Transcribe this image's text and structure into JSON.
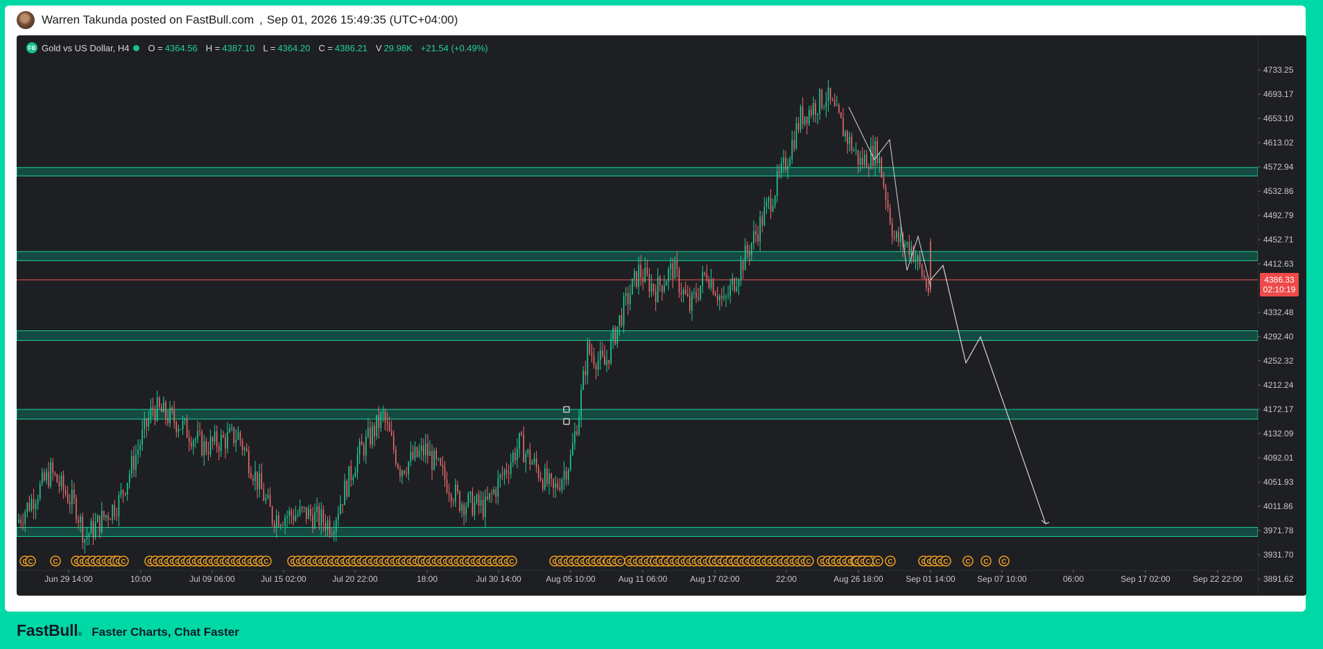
{
  "header": {
    "posted_by": "Warren Takunda posted on FastBull.com",
    "separator": ",",
    "timestamp": "Sep 01, 2026 15:49:35 (UTC+04:00)"
  },
  "legend": {
    "logo": "FB",
    "symbol": "Gold vs US Dollar, H4",
    "o_label": "O =",
    "o_value": "4364.56",
    "h_label": "H =",
    "h_value": "4387.10",
    "l_label": "L =",
    "l_value": "4364.20",
    "c_label": "C =",
    "c_value": "4386.21",
    "v_label": "V",
    "v_value": "29.98K",
    "change": "+21.54 (+0.49%)"
  },
  "price_tag": {
    "price": "4386.33",
    "countdown": "02:10:19"
  },
  "footer": {
    "logo": "FastBull",
    "reg": "®",
    "tagline": "Faster Charts, Chat Faster"
  },
  "colors": {
    "background": "#1e1f23",
    "up": "#1fd09a",
    "down": "#ee6b6b",
    "zone_fill": "#0c6e5b",
    "zone_border": "#1fd09a",
    "price_line": "#ee5555",
    "projection": "#d8d8d8",
    "event_markers": "#f0a020",
    "accent": "#00d9a6"
  },
  "chart_data": {
    "type": "candlestick",
    "symbol": "Gold vs US Dollar",
    "timeframe": "H4",
    "y_ticks": [
      4733.25,
      4693.17,
      4653.1,
      4613.02,
      4572.94,
      4532.86,
      4492.79,
      4452.71,
      4412.63,
      4386.33,
      4332.48,
      4292.4,
      4252.32,
      4212.24,
      4172.17,
      4132.09,
      4092.01,
      4051.93,
      4011.86,
      3971.78,
      3931.7,
      3891.62
    ],
    "x_ticks": [
      "Jun 29 14:00",
      "10:00",
      "Jul 09 06:00",
      "Jul 15 02:00",
      "Jul 20 22:00",
      "18:00",
      "Jul 30 14:00",
      "Aug 05 10:00",
      "Aug 11 06:00",
      "Aug 17 02:00",
      "22:00",
      "Aug 26 18:00",
      "Sep 01 14:00",
      "Sep 07 10:00",
      "06:00",
      "Sep 17 02:00",
      "Sep 22 22:00"
    ],
    "y_range": [
      3865,
      4745
    ],
    "last_price": 4386.33,
    "zones": [
      {
        "low": 4558,
        "high": 4572
      },
      {
        "low": 4418,
        "high": 4433
      },
      {
        "low": 4286,
        "high": 4302
      },
      {
        "low": 4156,
        "high": 4172
      },
      {
        "low": 3962,
        "high": 3977
      }
    ],
    "price_path": [
      [
        0,
        3985
      ],
      [
        4,
        4068
      ],
      [
        7,
        4010
      ],
      [
        8,
        3960
      ],
      [
        12,
        4020
      ],
      [
        16,
        4175
      ],
      [
        19,
        4150
      ],
      [
        22,
        4110
      ],
      [
        26,
        4130
      ],
      [
        30,
        3995
      ],
      [
        34,
        4000
      ],
      [
        37,
        3982
      ],
      [
        40,
        4095
      ],
      [
        43,
        4160
      ],
      [
        45,
        4075
      ],
      [
        48,
        4105
      ],
      [
        52,
        4020
      ],
      [
        55,
        4010
      ],
      [
        59,
        4115
      ],
      [
        63,
        4035
      ],
      [
        65,
        4090
      ],
      [
        66,
        4170
      ],
      [
        67,
        4270
      ],
      [
        69,
        4245
      ],
      [
        71,
        4330
      ],
      [
        73,
        4400
      ],
      [
        75,
        4370
      ],
      [
        77,
        4405
      ],
      [
        79,
        4340
      ],
      [
        81,
        4400
      ],
      [
        83,
        4345
      ],
      [
        85,
        4410
      ],
      [
        87,
        4470
      ],
      [
        90,
        4570
      ],
      [
        92,
        4655
      ],
      [
        95,
        4690
      ],
      [
        97,
        4635
      ],
      [
        99,
        4580
      ],
      [
        101,
        4600
      ],
      [
        103,
        4455
      ],
      [
        105,
        4440
      ],
      [
        107,
        4370
      ]
    ],
    "projection": [
      [
        4386,
        4410
      ],
      [
        4319,
        4249
      ],
      [
        4292,
        3983
      ]
    ],
    "zigzag": [
      [
        4672,
        4585
      ],
      [
        4618,
        4402
      ],
      [
        4458,
        4375
      ]
    ],
    "event_marker_label": "C"
  }
}
